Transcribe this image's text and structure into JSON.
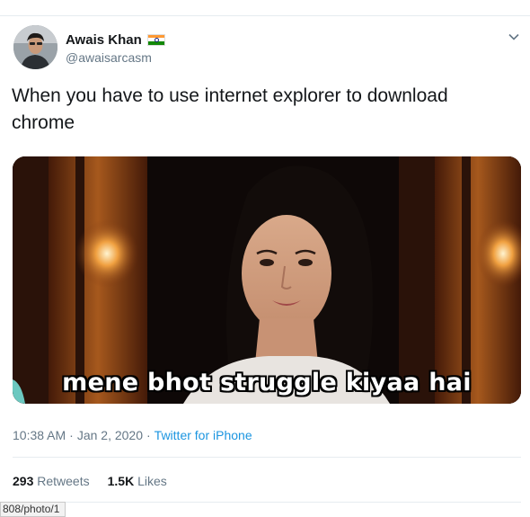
{
  "tweet": {
    "author": {
      "display_name": "Awais Khan",
      "handle": "@awaisarcasm",
      "flag_icon": "india-flag-icon"
    },
    "text": "When you have to use internet explorer to download chrome",
    "media": {
      "caption": "mene bhot struggle kiyaa hai"
    },
    "time": "10:38 AM",
    "separator": "·",
    "date": "Jan 2, 2020",
    "source": "Twitter for iPhone",
    "stats": {
      "retweets_count": "293",
      "retweets_label": "Retweets",
      "likes_count": "1.5K",
      "likes_label": "Likes"
    }
  },
  "status_bar": {
    "url": "808/photo/1"
  },
  "colors": {
    "text": "#14171a",
    "secondary": "#657786",
    "link": "#1b95e0",
    "border": "#e6ecf0"
  }
}
